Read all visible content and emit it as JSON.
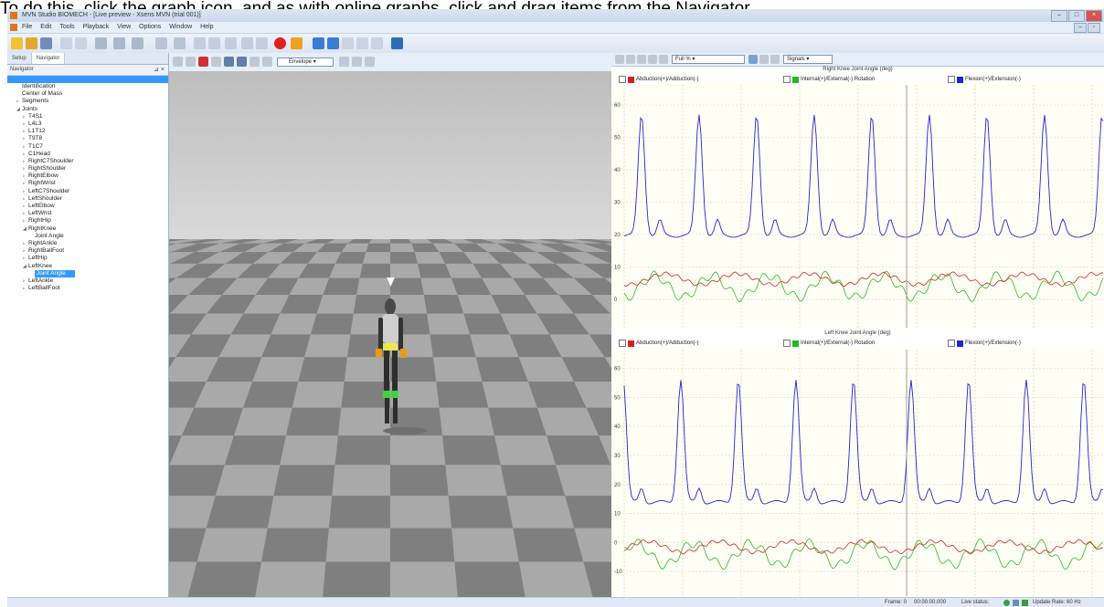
{
  "instruction": "To do this, click the graph icon, and as with online graphs, click and drag items from the Navigator.",
  "window": {
    "title": "MVN Studio BIOMECH - [Live preview - Xsens MVN (trial 001)]"
  },
  "menu": [
    "File",
    "Edit",
    "Tools",
    "Playback",
    "View",
    "Options",
    "Window",
    "Help"
  ],
  "tabs": [
    "Setup",
    "Navigator"
  ],
  "navigator": {
    "header": "Navigator",
    "tree": [
      {
        "label": "",
        "level": 0,
        "root": true
      },
      {
        "label": "Identification",
        "level": 1
      },
      {
        "label": "Center of Mass",
        "level": 1
      },
      {
        "label": "Segments",
        "level": 1,
        "expander": "▹"
      },
      {
        "label": "Joints",
        "level": 1,
        "expander": "◢"
      },
      {
        "label": "T4S1",
        "level": 2,
        "expander": "▹"
      },
      {
        "label": "L4L3",
        "level": 2,
        "expander": "▹"
      },
      {
        "label": "L1T12",
        "level": 2,
        "expander": "▹"
      },
      {
        "label": "T9T8",
        "level": 2,
        "expander": "▹"
      },
      {
        "label": "T1C7",
        "level": 2,
        "expander": "▹"
      },
      {
        "label": "C1Head",
        "level": 2,
        "expander": "▹"
      },
      {
        "label": "RightC7Shoulder",
        "level": 2,
        "expander": "▹"
      },
      {
        "label": "RightShoulder",
        "level": 2,
        "expander": "▹"
      },
      {
        "label": "RightElbow",
        "level": 2,
        "expander": "▹"
      },
      {
        "label": "RightWrist",
        "level": 2,
        "expander": "▹"
      },
      {
        "label": "LeftC7Shoulder",
        "level": 2,
        "expander": "▹"
      },
      {
        "label": "LeftShoulder",
        "level": 2,
        "expander": "▹"
      },
      {
        "label": "LeftElbow",
        "level": 2,
        "expander": "▹"
      },
      {
        "label": "LeftWrist",
        "level": 2,
        "expander": "▹"
      },
      {
        "label": "RightHip",
        "level": 2,
        "expander": "▹"
      },
      {
        "label": "RightKnee",
        "level": 2,
        "expander": "◢"
      },
      {
        "label": "Joint Angle",
        "level": 3
      },
      {
        "label": "RightAnkle",
        "level": 2,
        "expander": "▹"
      },
      {
        "label": "RightBallFoot",
        "level": 2,
        "expander": "▹"
      },
      {
        "label": "LeftHip",
        "level": 2,
        "expander": "▹"
      },
      {
        "label": "LeftKnee",
        "level": 2,
        "expander": "◢"
      },
      {
        "label": "Joint Angle",
        "level": 3,
        "selected": true
      },
      {
        "label": "LeftAnkle",
        "level": 2,
        "expander": "▹"
      },
      {
        "label": "LeftBallFoot",
        "level": 2,
        "expander": "▹"
      }
    ]
  },
  "viewport": {
    "view_select": "Envelope"
  },
  "graph_toolbar": {
    "zoom": "Full %",
    "layout": "Signals"
  },
  "graphs": [
    {
      "title": "Right Knee Joint Angle (deg)",
      "legend": [
        "Abduction(+)/Adduction(-)",
        "Internal(+)/External(-) Rotation",
        "Flexion(+)/Extension(-)"
      ]
    },
    {
      "title": "Left Knee Joint Angle (deg)",
      "legend": [
        "Abduction(+)/Adduction(-)",
        "Internal(+)/External(-) Rotation",
        "Flexion(+)/Extension(-)"
      ]
    }
  ],
  "series_colors": {
    "abduction": "#d42020",
    "rotation": "#22bb22",
    "flexion": "#2424d8"
  },
  "status": {
    "frame": "Frame: 0",
    "time": "00:00:00.000",
    "live": "Live status:",
    "update": "Update Rate: 60 Hz"
  }
}
